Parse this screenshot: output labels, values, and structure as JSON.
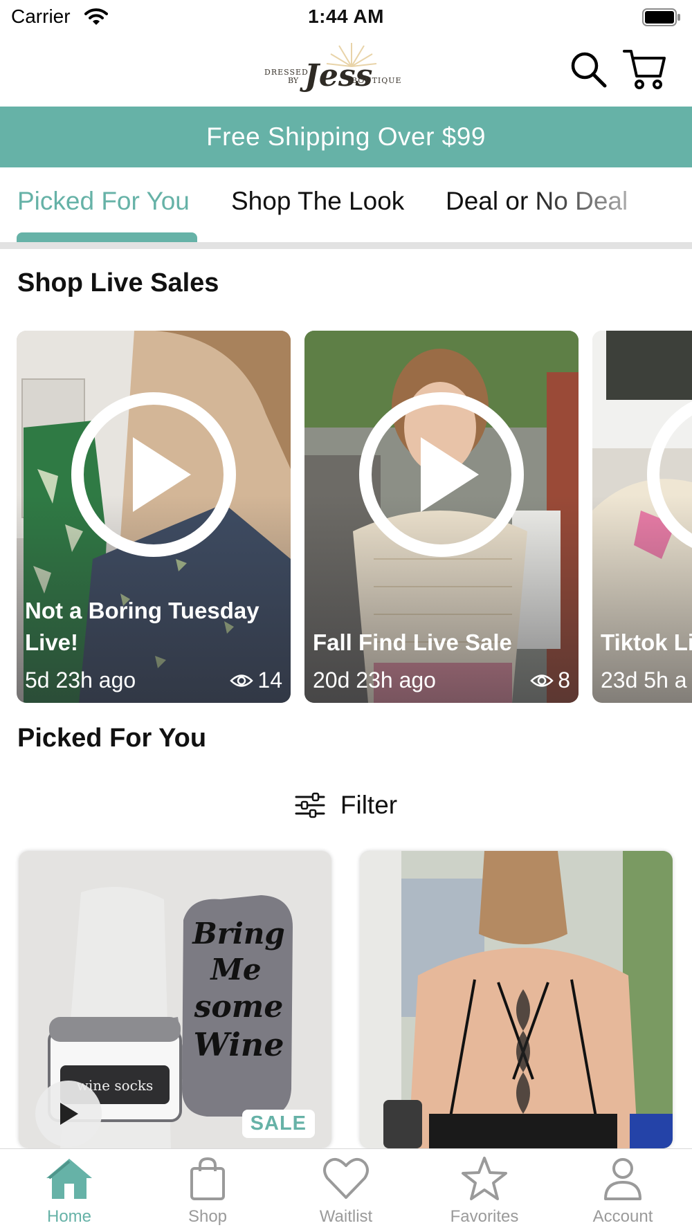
{
  "status_bar": {
    "carrier": "Carrier",
    "time": "1:44 AM"
  },
  "header": {
    "logo": {
      "text_left": "DRESSED",
      "text_by": "BY",
      "script": "Jess",
      "text_right": "BOUTIQUE"
    },
    "icons": [
      "search-icon",
      "cart-icon"
    ]
  },
  "promo": {
    "text": "Free Shipping Over $99"
  },
  "tabs": [
    {
      "label": "Picked For You",
      "active": true
    },
    {
      "label": "Shop The Look",
      "active": false
    },
    {
      "label": "Deal or No Deal",
      "active": false
    }
  ],
  "live_section": {
    "title": "Shop Live Sales",
    "cards": [
      {
        "title": "Not a Boring Tuesday Live!",
        "time": "5d 23h ago",
        "views": "14"
      },
      {
        "title": "Fall Find Live Sale",
        "time": "20d 23h ago",
        "views": "8"
      },
      {
        "title": "Tiktok Li",
        "time": "23d 5h a",
        "views": ""
      }
    ]
  },
  "picked_section": {
    "title": "Picked For You",
    "filter_label": "Filter",
    "products": [
      {
        "badge": "SALE",
        "has_video": true,
        "sock_text": "Bring Me some Wine",
        "cup_text": "wine socks"
      },
      {
        "badge": "",
        "has_video": false
      }
    ]
  },
  "bottom_nav": [
    {
      "label": "Home",
      "icon": "home-icon",
      "active": true
    },
    {
      "label": "Shop",
      "icon": "shopping-bag-icon",
      "active": false
    },
    {
      "label": "Waitlist",
      "icon": "heart-icon",
      "active": false
    },
    {
      "label": "Favorites",
      "icon": "star-icon",
      "active": false
    },
    {
      "label": "Account",
      "icon": "person-icon",
      "active": false
    }
  ],
  "colors": {
    "accent": "#66b2a7",
    "inactive": "#9a9a9a",
    "text": "#111111"
  }
}
